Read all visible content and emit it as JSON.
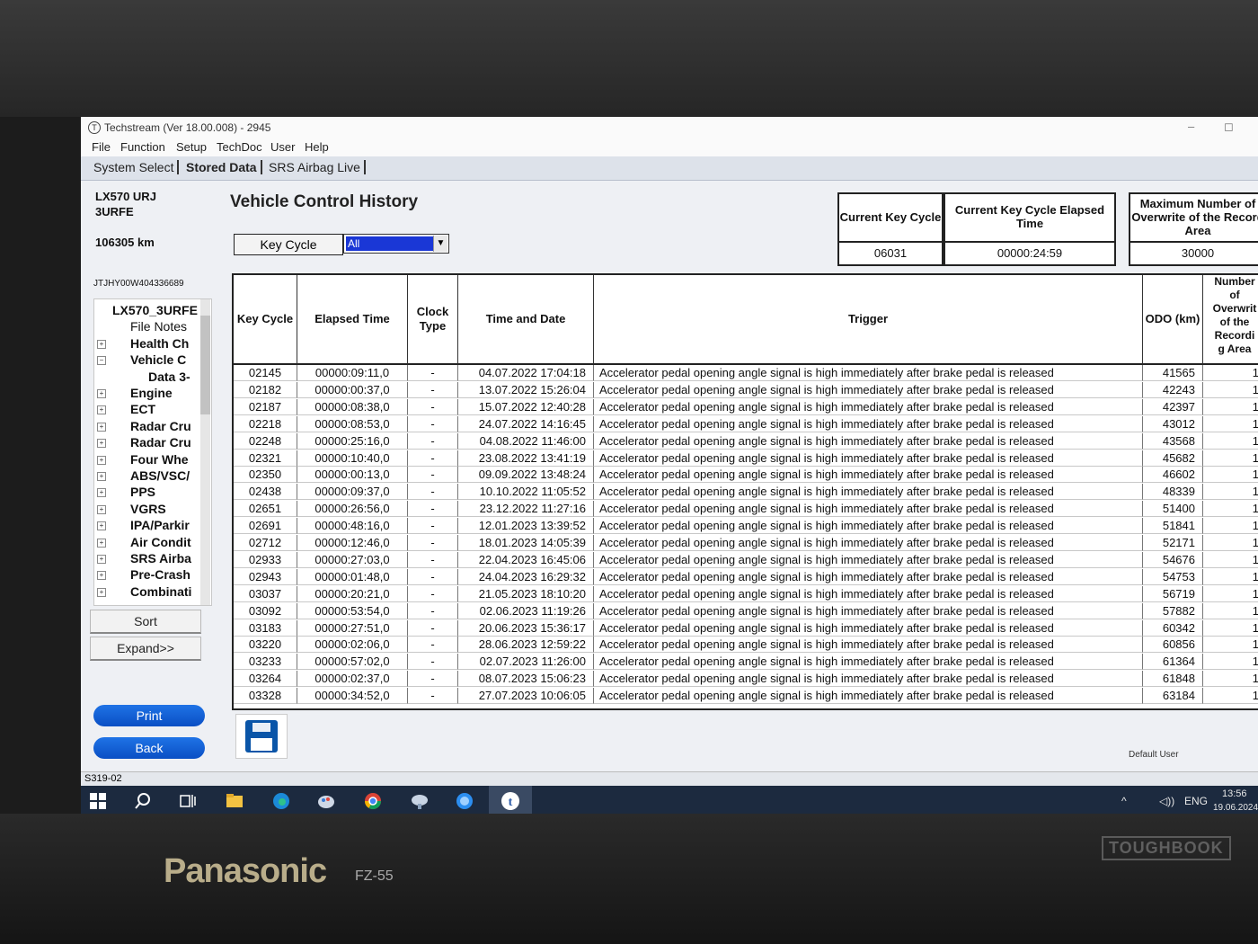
{
  "window": {
    "title": "Techstream (Ver 18.00.008) - 2945",
    "minimize": "–",
    "restore": "◻"
  },
  "menu": [
    "File",
    "Function",
    "Setup",
    "TechDoc",
    "User",
    "Help"
  ],
  "tabs": [
    "System Select",
    "Stored Data",
    "SRS Airbag Live"
  ],
  "sidebar": {
    "vehicle_line1": "LX570 URJ",
    "vehicle_line2": "3URFE",
    "odometer": "106305 km",
    "vin": "JTJHY00W404336689",
    "tree": [
      {
        "label": "LX570_3URFE",
        "expander": ""
      },
      {
        "label": "File Notes",
        "expander": ""
      },
      {
        "label": "Health Ch",
        "expander": "+"
      },
      {
        "label": "Vehicle C",
        "expander": "−"
      },
      {
        "label": "Data 3-",
        "expander": ""
      },
      {
        "label": "Engine",
        "expander": "+"
      },
      {
        "label": "ECT",
        "expander": "+"
      },
      {
        "label": "Radar Cru",
        "expander": "+"
      },
      {
        "label": "Radar Cru",
        "expander": "+"
      },
      {
        "label": "Four Whe",
        "expander": "+"
      },
      {
        "label": "ABS/VSC/",
        "expander": "+"
      },
      {
        "label": "PPS",
        "expander": "+"
      },
      {
        "label": "VGRS",
        "expander": "+"
      },
      {
        "label": "IPA/Parkir",
        "expander": "+"
      },
      {
        "label": "Air Condit",
        "expander": "+"
      },
      {
        "label": "SRS Airba",
        "expander": "+"
      },
      {
        "label": "Pre-Crash",
        "expander": "+"
      },
      {
        "label": "Combinati",
        "expander": "+"
      }
    ],
    "sort_label": "Sort",
    "expand_label": "Expand>>",
    "print_label": "Print",
    "back_label": "Back"
  },
  "main": {
    "title": "Vehicle Control History",
    "key_cycle_label": "Key Cycle",
    "key_cycle_value": "All",
    "current_key_cycle_label": "Current Key Cycle",
    "current_key_cycle_value": "06031",
    "elapsed_label_1": "Current Key Cycle Elapsed",
    "elapsed_label_2": "Time",
    "elapsed_value": "00000:24:59",
    "max_label_1": "Maximum Number of",
    "max_label_2": "Overwrite of the Record",
    "max_label_3": "Area",
    "max_value": "30000"
  },
  "table": {
    "columns": [
      "Key Cycle",
      "Elapsed Time",
      "Clock Type",
      "Time and Date",
      "Trigger",
      "ODO (km)",
      "Number of Overwrite of the Recording Area"
    ],
    "col_header_lines": {
      "clock_1": "Clock",
      "clock_2": "Type",
      "num_1": "Number",
      "num_2": "of",
      "num_3": "Overwrit",
      "num_4": "of the",
      "num_5": "Recordi",
      "num_6": "g Area"
    },
    "rows": [
      [
        "02145",
        "00000:09:11,0",
        "-",
        "04.07.2022 17:04:18",
        "Accelerator pedal opening angle signal is high immediately after brake pedal is released",
        "41565",
        "1"
      ],
      [
        "02182",
        "00000:00:37,0",
        "-",
        "13.07.2022 15:26:04",
        "Accelerator pedal opening angle signal is high immediately after brake pedal is released",
        "42243",
        "1"
      ],
      [
        "02187",
        "00000:08:38,0",
        "-",
        "15.07.2022 12:40:28",
        "Accelerator pedal opening angle signal is high immediately after brake pedal is released",
        "42397",
        "1"
      ],
      [
        "02218",
        "00000:08:53,0",
        "-",
        "24.07.2022 14:16:45",
        "Accelerator pedal opening angle signal is high immediately after brake pedal is released",
        "43012",
        "1"
      ],
      [
        "02248",
        "00000:25:16,0",
        "-",
        "04.08.2022 11:46:00",
        "Accelerator pedal opening angle signal is high immediately after brake pedal is released",
        "43568",
        "1"
      ],
      [
        "02321",
        "00000:10:40,0",
        "-",
        "23.08.2022 13:41:19",
        "Accelerator pedal opening angle signal is high immediately after brake pedal is released",
        "45682",
        "1"
      ],
      [
        "02350",
        "00000:00:13,0",
        "-",
        "09.09.2022 13:48:24",
        "Accelerator pedal opening angle signal is high immediately after brake pedal is released",
        "46602",
        "1"
      ],
      [
        "02438",
        "00000:09:37,0",
        "-",
        "10.10.2022 11:05:52",
        "Accelerator pedal opening angle signal is high immediately after brake pedal is released",
        "48339",
        "1"
      ],
      [
        "02651",
        "00000:26:56,0",
        "-",
        "23.12.2022 11:27:16",
        "Accelerator pedal opening angle signal is high immediately after brake pedal is released",
        "51400",
        "1"
      ],
      [
        "02691",
        "00000:48:16,0",
        "-",
        "12.01.2023 13:39:52",
        "Accelerator pedal opening angle signal is high immediately after brake pedal is released",
        "51841",
        "1"
      ],
      [
        "02712",
        "00000:12:46,0",
        "-",
        "18.01.2023 14:05:39",
        "Accelerator pedal opening angle signal is high immediately after brake pedal is released",
        "52171",
        "1"
      ],
      [
        "02933",
        "00000:27:03,0",
        "-",
        "22.04.2023 16:45:06",
        "Accelerator pedal opening angle signal is high immediately after brake pedal is released",
        "54676",
        "1"
      ],
      [
        "02943",
        "00000:01:48,0",
        "-",
        "24.04.2023 16:29:32",
        "Accelerator pedal opening angle signal is high immediately after brake pedal is released",
        "54753",
        "1"
      ],
      [
        "03037",
        "00000:20:21,0",
        "-",
        "21.05.2023 18:10:20",
        "Accelerator pedal opening angle signal is high immediately after brake pedal is released",
        "56719",
        "1"
      ],
      [
        "03092",
        "00000:53:54,0",
        "-",
        "02.06.2023 11:19:26",
        "Accelerator pedal opening angle signal is high immediately after brake pedal is released",
        "57882",
        "1"
      ],
      [
        "03183",
        "00000:27:51,0",
        "-",
        "20.06.2023 15:36:17",
        "Accelerator pedal opening angle signal is high immediately after brake pedal is released",
        "60342",
        "1"
      ],
      [
        "03220",
        "00000:02:06,0",
        "-",
        "28.06.2023 12:59:22",
        "Accelerator pedal opening angle signal is high immediately after brake pedal is released",
        "60856",
        "1"
      ],
      [
        "03233",
        "00000:57:02,0",
        "-",
        "02.07.2023 11:26:00",
        "Accelerator pedal opening angle signal is high immediately after brake pedal is released",
        "61364",
        "1"
      ],
      [
        "03264",
        "00000:02:37,0",
        "-",
        "08.07.2023 15:06:23",
        "Accelerator pedal opening angle signal is high immediately after brake pedal is released",
        "61848",
        "1"
      ],
      [
        "03328",
        "00000:34:52,0",
        "-",
        "27.07.2023 10:06:05",
        "Accelerator pedal opening angle signal is high immediately after brake pedal is released",
        "63184",
        "1"
      ]
    ]
  },
  "status": {
    "left": "S319-02",
    "user": "Default User"
  },
  "taskbar": {
    "lang": "ENG",
    "time": "13:56",
    "date": "19.06.2024",
    "tray_arrow": "^",
    "speaker": "◁))"
  },
  "device": {
    "brand": "Panasonic",
    "model": "FZ-55",
    "badge": "TOUGHBOOK"
  },
  "colors": {
    "accent_blue": "#0a4fc4",
    "selection_blue": "#1a37d6",
    "taskbar": "#1c2a3f"
  }
}
